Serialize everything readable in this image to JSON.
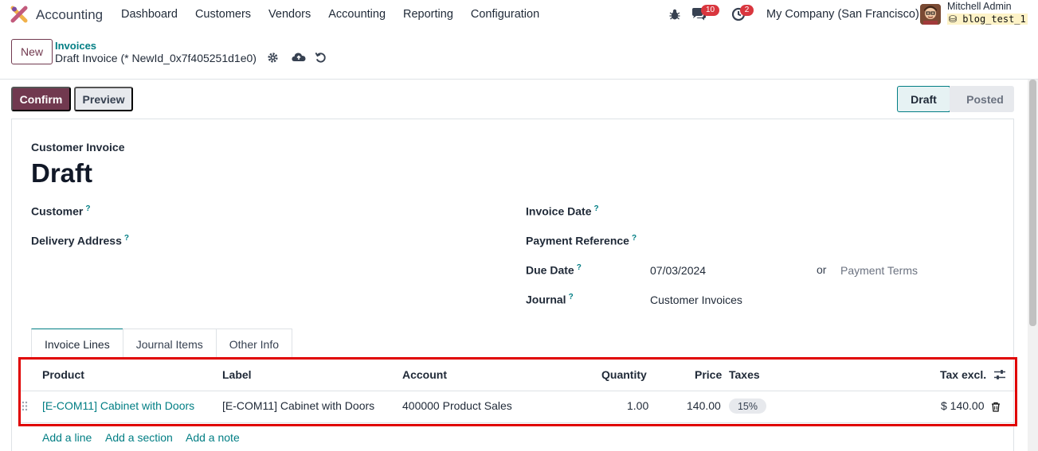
{
  "navbar": {
    "app_name": "Accounting",
    "menu": [
      "Dashboard",
      "Customers",
      "Vendors",
      "Accounting",
      "Reporting",
      "Configuration"
    ],
    "messages_count": "10",
    "activities_count": "2",
    "company": "My Company (San Francisco)",
    "user_name": "Mitchell Admin",
    "database": "blog_test_1"
  },
  "control_panel": {
    "new_label": "New",
    "breadcrumb": "Invoices",
    "record_name": "Draft Invoice (* NewId_0x7f405251d1e0)"
  },
  "actions": {
    "confirm_label": "Confirm",
    "preview_label": "Preview"
  },
  "statusbar": {
    "current": "Draft",
    "next": "Posted"
  },
  "form": {
    "document_type": "Customer Invoice",
    "title": "Draft",
    "customer_label": "Customer",
    "delivery_label": "Delivery Address",
    "invoice_date_label": "Invoice Date",
    "payment_ref_label": "Payment Reference",
    "due_date_label": "Due Date",
    "due_date_value": "07/03/2024",
    "or_label": "or",
    "payment_terms_placeholder": "Payment Terms",
    "journal_label": "Journal",
    "journal_value": "Customer Invoices",
    "help_mark": "?"
  },
  "tabs": [
    "Invoice Lines",
    "Journal Items",
    "Other Info"
  ],
  "lines_table": {
    "headers": {
      "product": "Product",
      "label": "Label",
      "account": "Account",
      "quantity": "Quantity",
      "price": "Price",
      "taxes": "Taxes",
      "tax_excl": "Tax excl."
    },
    "rows": [
      {
        "product": "[E-COM11] Cabinet with Doors",
        "label": "[E-COM11] Cabinet with Doors",
        "account": "400000 Product Sales",
        "quantity": "1.00",
        "price": "140.00",
        "tax": "15%",
        "subtotal": "$ 140.00"
      }
    ],
    "add_line": "Add a line",
    "add_section": "Add a section",
    "add_note": "Add a note"
  },
  "colors": {
    "brand": "#71394f",
    "link": "#017e84",
    "highlight": "#e00000"
  }
}
